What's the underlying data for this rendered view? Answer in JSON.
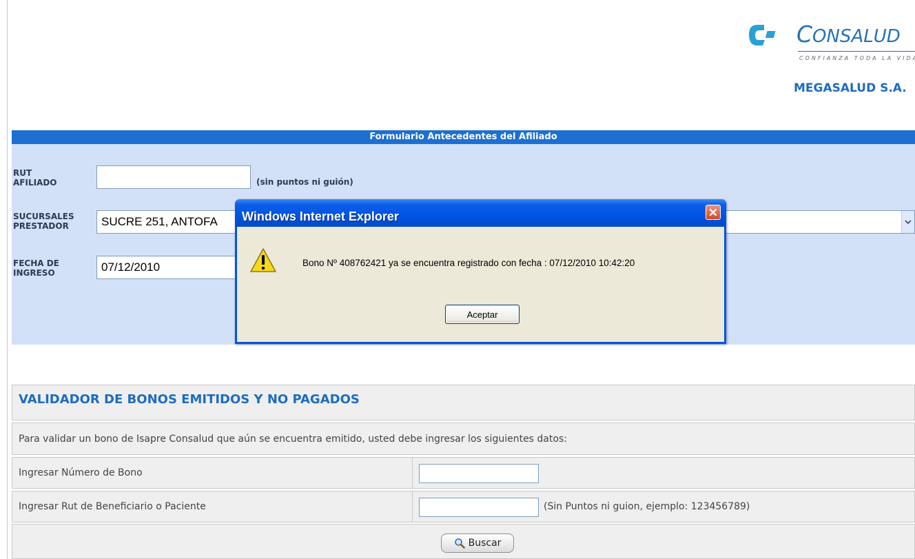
{
  "brand": {
    "name_big": "C",
    "name_rest": "ONSALUD",
    "tagline": "CONFIANZA TODA LA VIDA",
    "provider": "MEGASALUD S.A."
  },
  "form": {
    "header": "Formulario Antecedentes del Afiliado",
    "rut_label_1": "RUT",
    "rut_label_2": "AFILIADO",
    "rut_value": "",
    "rut_hint": "(sin puntos ni guión)",
    "sucursal_label_1": "SUCURSALES",
    "sucursal_label_2": "PRESTADOR",
    "sucursal_value": "SUCRE 251, ANTOFA",
    "fecha_label_1": "FECHA DE",
    "fecha_label_2": "INGRESO",
    "fecha_value": "07/12/2010"
  },
  "validator": {
    "title": "VALIDADOR DE BONOS EMITIDOS Y NO PAGADOS",
    "intro": "Para validar un bono de Isapre Consalud que aún se encuentra emitido, usted debe ingresar los siguientes datos:",
    "bono_label": "Ingresar Número de Bono",
    "bono_value": "",
    "rut_label": "Ingresar Rut de Beneficiario o Paciente",
    "rut_value": "",
    "rut_hint": "(Sin Puntos ni guion, ejemplo: 123456789)",
    "search_button": "Buscar"
  },
  "dialog": {
    "title": "Windows Internet Explorer",
    "message": "Bono Nº 408762421 ya se encuentra registrado con fecha : 07/12/2010 10:42:20",
    "ok_button": "Aceptar",
    "icon": "warning-icon"
  },
  "colors": {
    "brand_blue": "#1d6cc0",
    "form_bg": "#d2e1f7",
    "header_bg": "#1d6fd0",
    "dialog_blue": "#0054e3",
    "dialog_body": "#ece9d8"
  }
}
